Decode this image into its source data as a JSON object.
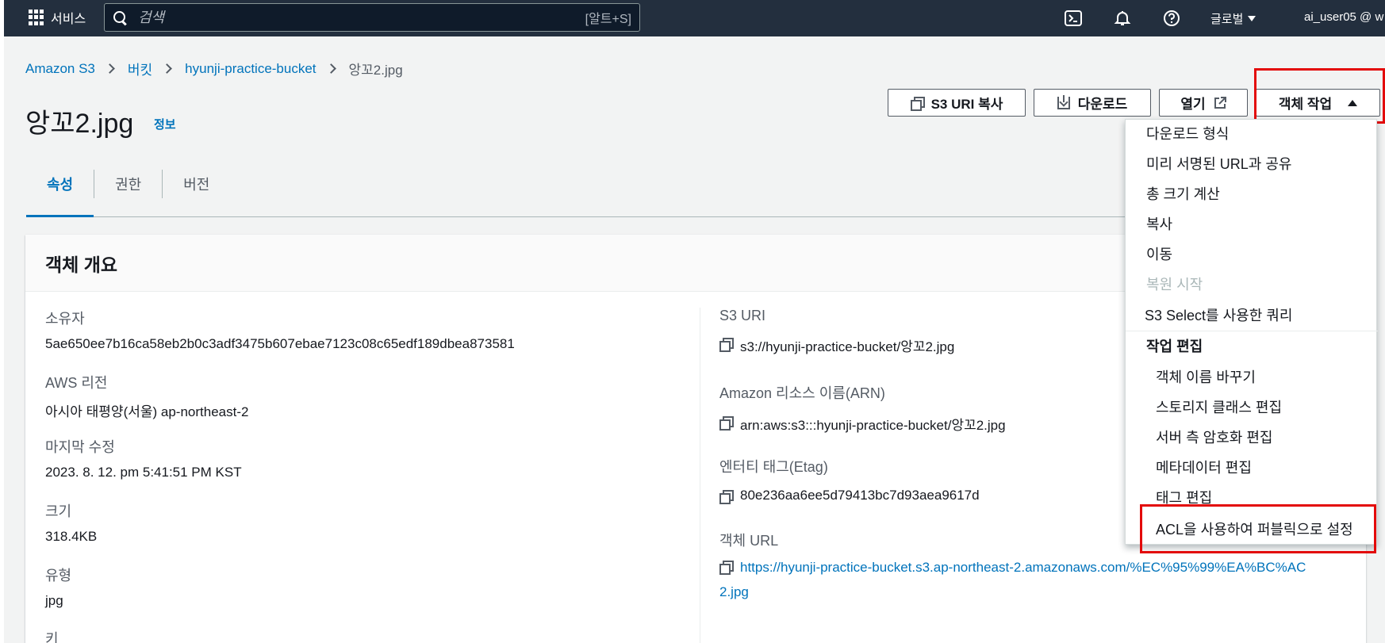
{
  "nav": {
    "services_label": "서비스",
    "search_placeholder": "검색",
    "search_shortcut": "[알트+S]",
    "region_label": "글로벌",
    "user_label": "ai_user05 @ w"
  },
  "breadcrumb": {
    "items": [
      "Amazon S3",
      "버킷",
      "hyunji-practice-bucket"
    ],
    "current": "앙꼬2.jpg"
  },
  "page": {
    "title": "앙꼬2.jpg",
    "info_link": "정보"
  },
  "actions": {
    "copy_uri": "S3 URI 복사",
    "download": "다운로드",
    "open": "열기",
    "object_actions": "객체 작업"
  },
  "tabs": [
    "속성",
    "권한",
    "버전"
  ],
  "overview": {
    "title": "객체 개요",
    "owner_label": "소유자",
    "owner_value": "5ae650ee7b16ca58eb2b0c3adf3475b607ebae7123c08c65edf189dbea873581",
    "region_label": "AWS 리전",
    "region_value": "아시아 태평양(서울) ap-northeast-2",
    "modified_label": "마지막 수정",
    "modified_value": "2023. 8. 12. pm 5:41:51 PM KST",
    "size_label": "크기",
    "size_value": "318.4KB",
    "type_label": "유형",
    "type_value": "jpg",
    "key_label": "키",
    "s3uri_label": "S3 URI",
    "s3uri_value": "s3://hyunji-practice-bucket/앙꼬2.jpg",
    "arn_label": "Amazon 리소스 이름(ARN)",
    "arn_value": "arn:aws:s3:::hyunji-practice-bucket/앙꼬2.jpg",
    "etag_label": "엔터티 태그(Etag)",
    "etag_value": "80e236aa6ee5d79413bc7d93aea9617d",
    "url_label": "객체 URL",
    "url_line1": "https://hyunji-practice-bucket.s3.ap-northeast-2.amazonaws.com/%EC%95%99%EA%BC%AC",
    "url_line2": "2.jpg"
  },
  "menu": {
    "download_as": "다운로드 형식",
    "presigned": "미리 서명된 URL과 공유",
    "calc_size": "총 크기 계산",
    "copy": "복사",
    "move": "이동",
    "restore": "복원 시작",
    "s3select": "S3 Select를 사용한 쿼리",
    "edit_group": "작업 편집",
    "rename": "객체 이름 바꾸기",
    "storage_class": "스토리지 클래스 편집",
    "encryption": "서버 측 암호화 편집",
    "metadata": "메타데이터 편집",
    "tags": "태그 편집",
    "acl_public": "ACL을 사용하여 퍼블릭으로 설정"
  },
  "colors": {
    "nav_bg": "#232f3e",
    "link": "#0073bb",
    "highlight": "#e30a0a"
  }
}
